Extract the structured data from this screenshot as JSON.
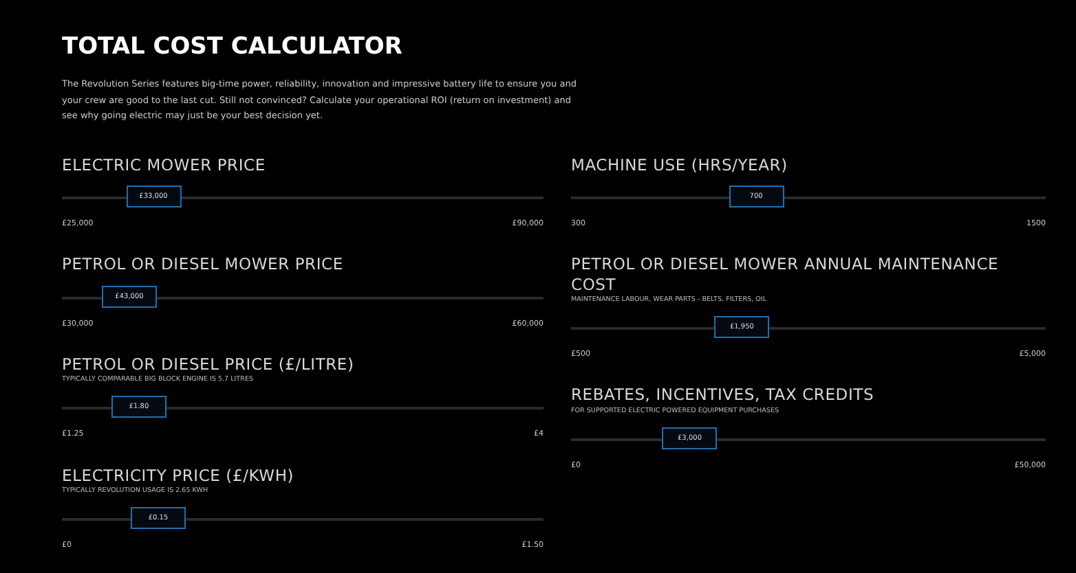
{
  "title": "TOTAL COST CALCULATOR",
  "intro": "The Revolution Series features big-time power, reliability, innovation and impressive battery life to ensure you and your crew are good to the last cut. Still not convinced? Calculate your operational ROI (return on investment) and see why going electric may just be your best decision yet.",
  "columns": [
    {
      "sliders": [
        {
          "label": "ELECTRIC MOWER PRICE",
          "value": "£33,000",
          "min": "£25,000",
          "max": "£90,000",
          "level": 0.19
        },
        {
          "label": "PETROL OR DIESEL MOWER PRICE",
          "value": "£43,000",
          "min": "£30,000",
          "max": "£60,000",
          "level": 0.14
        },
        {
          "label": "PETROL OR DIESEL PRICE (£/LITRE)",
          "subtitle": "TYPICALLY COMPARABLE BIG BLOCK ENGINE IS 5.7 LITRES",
          "value": "£1.80",
          "min": "£1.25",
          "max": "£4",
          "level": 0.16
        },
        {
          "label": "ELECTRICITY PRICE (£/KWH)",
          "subtitle": "TYPICALLY REVOLUTION USAGE IS 2.65 KWH",
          "value": "£0.15",
          "min": "£0",
          "max": "£1.50",
          "level": 0.2
        }
      ]
    },
    {
      "sliders": [
        {
          "label": "MACHINE USE (HRS/YEAR)",
          "value": "700",
          "min": "300",
          "max": "1500",
          "level": 0.39
        },
        {
          "label": "PETROL OR DIESEL MOWER ANNUAL MAINTENANCE COST",
          "subtitle": "MAINTENANCE LABOUR, WEAR PARTS - BELTS, FILTERS, OIL",
          "value": "£1,950",
          "min": "£500",
          "max": "£5,000",
          "level": 0.36
        },
        {
          "label": "REBATES, INCENTIVES, TAX CREDITS",
          "subtitle": "FOR SUPPORTED ELECTRIC POWERED EQUIPMENT PURCHASES",
          "value": "£3,000",
          "min": "£0",
          "max": "£50,000",
          "level": 0.25
        }
      ]
    }
  ]
}
